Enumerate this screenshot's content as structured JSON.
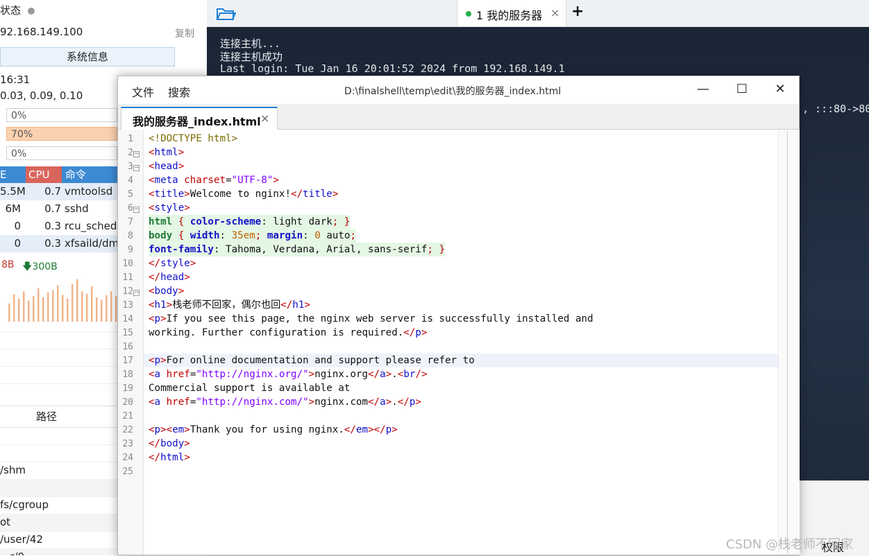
{
  "left_panel": {
    "status_label": "状态",
    "ip": "92.168.149.100",
    "copy": "复制",
    "sysinfo_button": "系统信息",
    "uptime": "16:31",
    "load": "0.03, 0.09, 0.10",
    "meters": [
      "0%",
      "70%",
      "0%"
    ],
    "proc_headers": {
      "mem": "E",
      "cpu": "CPU",
      "cmd": "命令"
    },
    "processes": [
      {
        "mem": "5.5M",
        "cpu": "0.7",
        "cmd": "vmtoolsd"
      },
      {
        "mem": "6M",
        "cpu": "0.7",
        "cmd": "sshd"
      },
      {
        "mem": "0",
        "cpu": "0.3",
        "cmd": "rcu_sched"
      },
      {
        "mem": "0",
        "cpu": "0.3",
        "cmd": "xfsaild/dm"
      }
    ],
    "net_up": "8B",
    "net_down": "300B",
    "net_bars": [
      30,
      45,
      38,
      50,
      35,
      42,
      55,
      40,
      48,
      52,
      60,
      44,
      38,
      62,
      70,
      50,
      46,
      58,
      40,
      36,
      44,
      50,
      42
    ],
    "path_header": "路径",
    "paths": [
      "/shm",
      "",
      "fs/cgroup",
      "ot",
      "/user/42",
      "...r/0"
    ]
  },
  "top_tabs": {
    "tab_label": "1 我的服务器",
    "close": "×",
    "add": "+"
  },
  "terminal": {
    "lines": [
      "连接主机...",
      "连接主机成功",
      "Last login: Tue Jan 16 20:01:52 2024 from 192.168.149.1"
    ],
    "side_text": ", :::80->80/"
  },
  "editor": {
    "menu_file": "文件",
    "menu_search": "搜索",
    "path": "D:\\finalshell\\temp\\edit\\我的服务器_index.html",
    "minimize": "—",
    "maximize": "☐",
    "close": "✕",
    "tab_label": "我的服务器_index.html",
    "tab_close": "×",
    "line_numbers": [
      "1",
      "2",
      "3",
      "4",
      "5",
      "6",
      "7",
      "8",
      "9",
      "10",
      "11",
      "12",
      "13",
      "14",
      "15",
      "16",
      "17",
      "18",
      "19",
      "20",
      "21",
      "22",
      "23",
      "24",
      "25"
    ]
  },
  "footer": {
    "permission_label": "权限",
    "watermark": "CSDN @栈老师不回家"
  }
}
